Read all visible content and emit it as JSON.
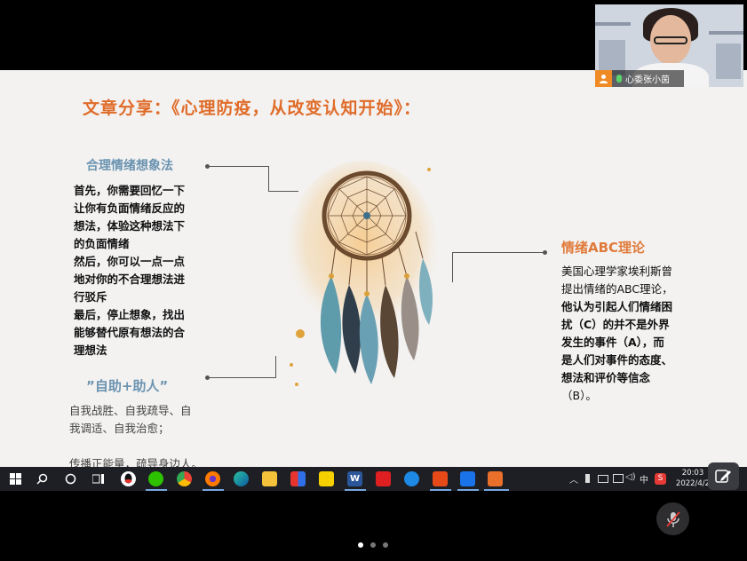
{
  "slide": {
    "title": "文章分享：《心理防疫，从改变认知开始》：",
    "left_heading": "合理情绪想象法",
    "left_lines": [
      "首先，你需要回忆一下",
      "让你有负面情绪反应的",
      "想法，体验这种想法下",
      "的负面情绪",
      "然后，你可以一点一点",
      "地对你的不合理想法进",
      "行驳斥",
      "最后，停止想象，找出",
      "能够替代原有想法的合",
      "理想法"
    ],
    "help_heading": "”自助+助人”",
    "help_lines": [
      "自我战胜、自我疏导、自",
      "我调适、自我治愈；",
      "",
      "传播正能量，疏导身边人。"
    ],
    "right_heading": "情绪ABC理论",
    "right_lines": [
      "美国心理学家埃利斯曾",
      "提出情绪的ABC理论，",
      "他认为引起人们情绪困",
      "扰（C）的并不是外界",
      "发生的事件（A），而",
      "是人们对事件的态度、",
      "想法和评价等信念",
      "（B）。"
    ]
  },
  "video": {
    "participant_name": "心委张小茵"
  },
  "taskbar": {
    "apps": [
      "qq-icon",
      "wechat-icon",
      "chrome-icon",
      "firefox-icon",
      "edge-icon",
      "file-explorer-icon",
      "app-icon",
      "sticky-notes-icon",
      "word-icon",
      "baidu-icon",
      "browser-icon",
      "app-icon",
      "meeting-icon",
      "video-player-icon"
    ],
    "word_label": "W",
    "ime_label": "中",
    "tray_s_label": "S",
    "time": "20:03",
    "date": "2022/4/2"
  }
}
